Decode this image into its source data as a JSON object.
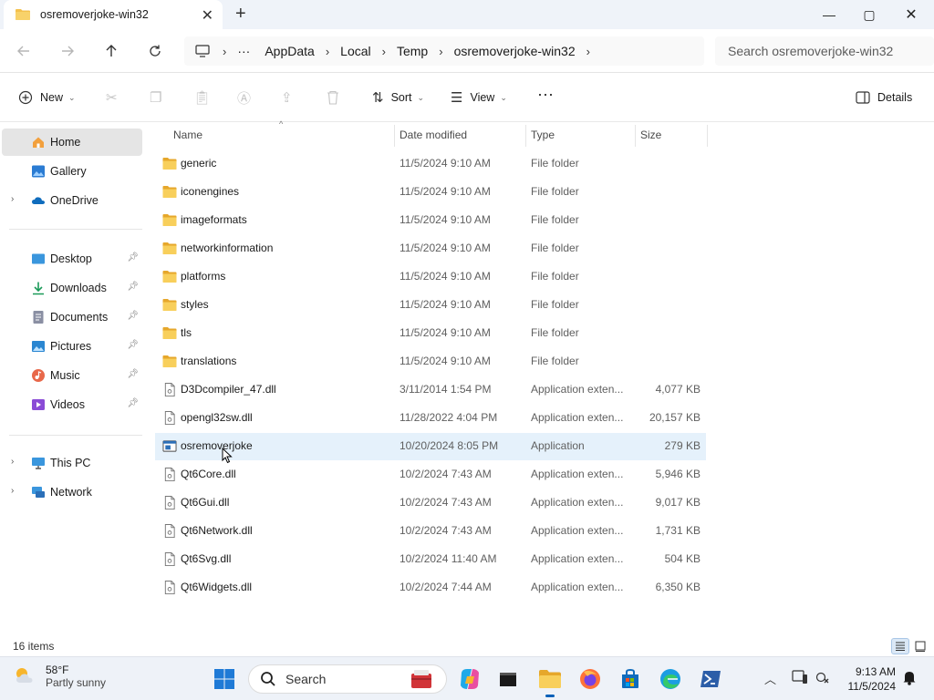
{
  "tab": {
    "title": "osremoverjoke-win32",
    "close": "✕",
    "new": "+"
  },
  "window_controls": {
    "minimize": "—",
    "maximize": "▢",
    "close": "✕"
  },
  "address": {
    "more": "···",
    "crumbs": [
      "AppData",
      "Local",
      "Temp",
      "osremoverjoke-win32"
    ],
    "search_placeholder": "Search osremoverjoke-win32"
  },
  "commands": {
    "new": "New",
    "sort": "Sort",
    "view": "View",
    "more": "···",
    "details": "Details"
  },
  "sidebar": {
    "home": "Home",
    "gallery": "Gallery",
    "onedrive": "OneDrive",
    "desktop": "Desktop",
    "downloads": "Downloads",
    "documents": "Documents",
    "pictures": "Pictures",
    "music": "Music",
    "videos": "Videos",
    "thispc": "This PC",
    "network": "Network"
  },
  "columns": {
    "name": "Name",
    "date": "Date modified",
    "type": "Type",
    "size": "Size"
  },
  "files": [
    {
      "name": "generic",
      "date": "11/5/2024 9:10 AM",
      "type": "File folder",
      "size": "",
      "kind": "folder"
    },
    {
      "name": "iconengines",
      "date": "11/5/2024 9:10 AM",
      "type": "File folder",
      "size": "",
      "kind": "folder"
    },
    {
      "name": "imageformats",
      "date": "11/5/2024 9:10 AM",
      "type": "File folder",
      "size": "",
      "kind": "folder"
    },
    {
      "name": "networkinformation",
      "date": "11/5/2024 9:10 AM",
      "type": "File folder",
      "size": "",
      "kind": "folder"
    },
    {
      "name": "platforms",
      "date": "11/5/2024 9:10 AM",
      "type": "File folder",
      "size": "",
      "kind": "folder"
    },
    {
      "name": "styles",
      "date": "11/5/2024 9:10 AM",
      "type": "File folder",
      "size": "",
      "kind": "folder"
    },
    {
      "name": "tls",
      "date": "11/5/2024 9:10 AM",
      "type": "File folder",
      "size": "",
      "kind": "folder"
    },
    {
      "name": "translations",
      "date": "11/5/2024 9:10 AM",
      "type": "File folder",
      "size": "",
      "kind": "folder"
    },
    {
      "name": "D3Dcompiler_47.dll",
      "date": "3/11/2014 1:54 PM",
      "type": "Application exten...",
      "size": "4,077 KB",
      "kind": "dll"
    },
    {
      "name": "opengl32sw.dll",
      "date": "11/28/2022 4:04 PM",
      "type": "Application exten...",
      "size": "20,157 KB",
      "kind": "dll"
    },
    {
      "name": "osremoverjoke",
      "date": "10/20/2024 8:05 PM",
      "type": "Application",
      "size": "279 KB",
      "kind": "exe"
    },
    {
      "name": "Qt6Core.dll",
      "date": "10/2/2024 7:43 AM",
      "type": "Application exten...",
      "size": "5,946 KB",
      "kind": "dll"
    },
    {
      "name": "Qt6Gui.dll",
      "date": "10/2/2024 7:43 AM",
      "type": "Application exten...",
      "size": "9,017 KB",
      "kind": "dll"
    },
    {
      "name": "Qt6Network.dll",
      "date": "10/2/2024 7:43 AM",
      "type": "Application exten...",
      "size": "1,731 KB",
      "kind": "dll"
    },
    {
      "name": "Qt6Svg.dll",
      "date": "10/2/2024 11:40 AM",
      "type": "Application exten...",
      "size": "504 KB",
      "kind": "dll"
    },
    {
      "name": "Qt6Widgets.dll",
      "date": "10/2/2024 7:44 AM",
      "type": "Application exten...",
      "size": "6,350 KB",
      "kind": "dll"
    }
  ],
  "status": {
    "count": "16 items"
  },
  "taskbar": {
    "temp": "58°F",
    "condition": "Partly sunny",
    "search": "Search",
    "time": "9:13 AM",
    "date": "11/5/2024"
  },
  "colors": {
    "accent": "#005fb8",
    "folder": "#f4c14d",
    "hover_row": "#e5f1fb"
  }
}
